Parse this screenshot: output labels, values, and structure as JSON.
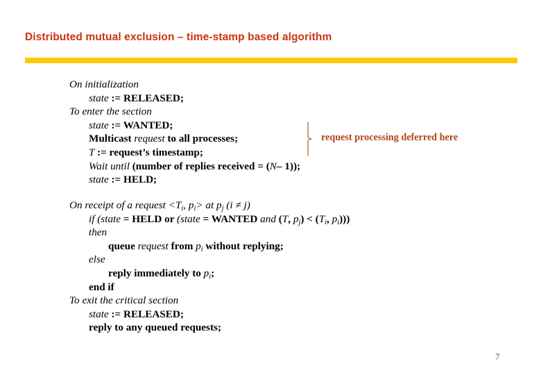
{
  "slide": {
    "title": "Distributed mutual exclusion – time-stamp based algorithm",
    "page_number": "7",
    "accent_bar_color": "#ffc809",
    "title_color": "#cc3311",
    "annotation_color": "#b1451c"
  },
  "annotation": {
    "text": "request processing deferred here",
    "brace_icon": "curly-brace-icon"
  },
  "algorithm": {
    "block_one": {
      "lines": [
        {
          "indent": 0,
          "tokens": [
            {
              "style": "kw",
              "text": "On initialization"
            }
          ]
        },
        {
          "indent": 1,
          "tokens": [
            {
              "style": "var",
              "text": "state "
            },
            {
              "style": "op",
              "text": ":= "
            },
            {
              "style": "cst",
              "text": "RELEASED;"
            }
          ]
        },
        {
          "indent": 0,
          "tokens": [
            {
              "style": "kw",
              "text": "To enter the section"
            }
          ]
        },
        {
          "indent": 1,
          "tokens": [
            {
              "style": "var",
              "text": "state "
            },
            {
              "style": "op",
              "text": ":= "
            },
            {
              "style": "cst",
              "text": "WANTED;"
            }
          ]
        },
        {
          "indent": 1,
          "tokens": [
            {
              "style": "bd",
              "text": "Multicast "
            },
            {
              "style": "var",
              "text": "request"
            },
            {
              "style": "bd",
              "text": " to all processes;"
            }
          ]
        },
        {
          "indent": 1,
          "tokens": [
            {
              "style": "var",
              "text": "T "
            },
            {
              "style": "op",
              "text": ":= "
            },
            {
              "style": "bd",
              "text": "request’s timestamp;"
            }
          ]
        },
        {
          "indent": 1,
          "tokens": [
            {
              "style": "kw",
              "text": "Wait until "
            },
            {
              "style": "bd",
              "text": "(number of replies received = ("
            },
            {
              "style": "var",
              "text": "N"
            },
            {
              "style": "bd",
              "text": "– 1));"
            }
          ]
        },
        {
          "indent": 1,
          "tokens": [
            {
              "style": "var",
              "text": "state "
            },
            {
              "style": "op",
              "text": ":= "
            },
            {
              "style": "cst",
              "text": "HELD;"
            }
          ]
        }
      ]
    },
    "block_two": {
      "lines": [
        {
          "indent": 0,
          "tokens": [
            {
              "style": "kw",
              "text": "On receipt of a request <"
            },
            {
              "style": "var",
              "text": "T",
              "sub": "i"
            },
            {
              "style": "kw",
              "text": ", "
            },
            {
              "style": "var",
              "text": "p",
              "sub": "i"
            },
            {
              "style": "kw",
              "text": "> at "
            },
            {
              "style": "var",
              "text": "p",
              "sub": "j"
            },
            {
              "style": "kw",
              "text": " (i ≠ j)"
            }
          ]
        },
        {
          "indent": 1,
          "tokens": [
            {
              "style": "kw",
              "text": "if "
            },
            {
              "style": "var",
              "text": "(state "
            },
            {
              "style": "op",
              "text": "= "
            },
            {
              "style": "cst",
              "text": "HELD "
            },
            {
              "style": "bd",
              "text": "or "
            },
            {
              "style": "var",
              "text": "(state "
            },
            {
              "style": "op",
              "text": "= "
            },
            {
              "style": "cst",
              "text": "WANTED "
            },
            {
              "style": "kw",
              "text": "and "
            },
            {
              "style": "bd",
              "text": "("
            },
            {
              "style": "var",
              "text": "T"
            },
            {
              "style": "bd",
              "text": ", "
            },
            {
              "style": "var",
              "text": "p",
              "sub": "j"
            },
            {
              "style": "bd",
              "text": ") < ("
            },
            {
              "style": "var",
              "text": "T",
              "sub": "i"
            },
            {
              "style": "bd",
              "text": ", "
            },
            {
              "style": "var",
              "text": "p",
              "sub": "i"
            },
            {
              "style": "bd",
              "text": ")))"
            }
          ]
        },
        {
          "indent": 1,
          "tokens": [
            {
              "style": "kw",
              "text": "then"
            }
          ]
        },
        {
          "indent": 2,
          "tokens": [
            {
              "style": "bd",
              "text": "queue "
            },
            {
              "style": "var",
              "text": "request"
            },
            {
              "style": "bd",
              "text": " from "
            },
            {
              "style": "var",
              "text": "p",
              "sub": "i"
            },
            {
              "style": "bd",
              "text": " without replying;"
            }
          ]
        },
        {
          "indent": 1,
          "tokens": [
            {
              "style": "kw",
              "text": "else"
            }
          ]
        },
        {
          "indent": 2,
          "tokens": [
            {
              "style": "bd",
              "text": "reply immediately to "
            },
            {
              "style": "var",
              "text": "p",
              "sub": "i"
            },
            {
              "style": "bd",
              "text": ";"
            }
          ]
        },
        {
          "indent": 1,
          "tokens": [
            {
              "style": "bd",
              "text": "end if"
            }
          ]
        },
        {
          "indent": 0,
          "tokens": [
            {
              "style": "kw",
              "text": "To exit the critical section"
            }
          ]
        },
        {
          "indent": 1,
          "tokens": [
            {
              "style": "var",
              "text": "state "
            },
            {
              "style": "op",
              "text": ":= "
            },
            {
              "style": "cst",
              "text": "RELEASED;"
            }
          ]
        },
        {
          "indent": 1,
          "tokens": [
            {
              "style": "bd",
              "text": "reply to any queued requests;"
            }
          ]
        }
      ]
    }
  }
}
